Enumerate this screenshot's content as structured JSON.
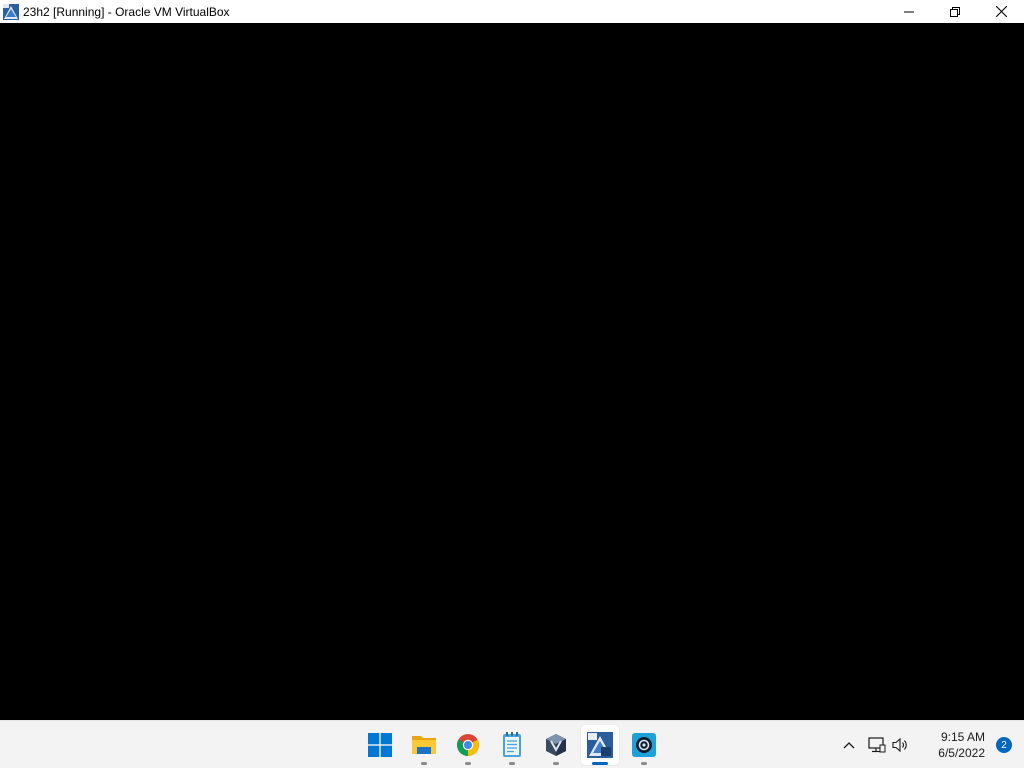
{
  "window": {
    "title": "23h2 [Running] - Oracle VM VirtualBox",
    "icon": "virtualbox-vm-icon",
    "controls": [
      "minimize-icon",
      "restore-icon",
      "close-icon"
    ]
  },
  "vm_screen": {
    "background": "#000000"
  },
  "taskbar": {
    "apps": [
      {
        "name": "start",
        "icon": "windows-start-icon"
      },
      {
        "name": "file-explorer",
        "icon": "folder-icon"
      },
      {
        "name": "chrome",
        "icon": "chrome-icon"
      },
      {
        "name": "notepad",
        "icon": "notepad-icon"
      },
      {
        "name": "virtualbox",
        "icon": "virtualbox-icon"
      },
      {
        "name": "virtualbox-vm",
        "icon": "virtualbox-vm-icon",
        "active": true
      },
      {
        "name": "app-settings",
        "icon": "gear-app-icon"
      }
    ],
    "tray": {
      "icons": [
        "chevron-up-icon",
        "network-icon",
        "volume-icon"
      ],
      "time": "9:15 AM",
      "date": "6/5/2022",
      "notifications": "2"
    }
  },
  "colors": {
    "accent": "#0067c0",
    "taskbar": "#f3f3f3"
  }
}
